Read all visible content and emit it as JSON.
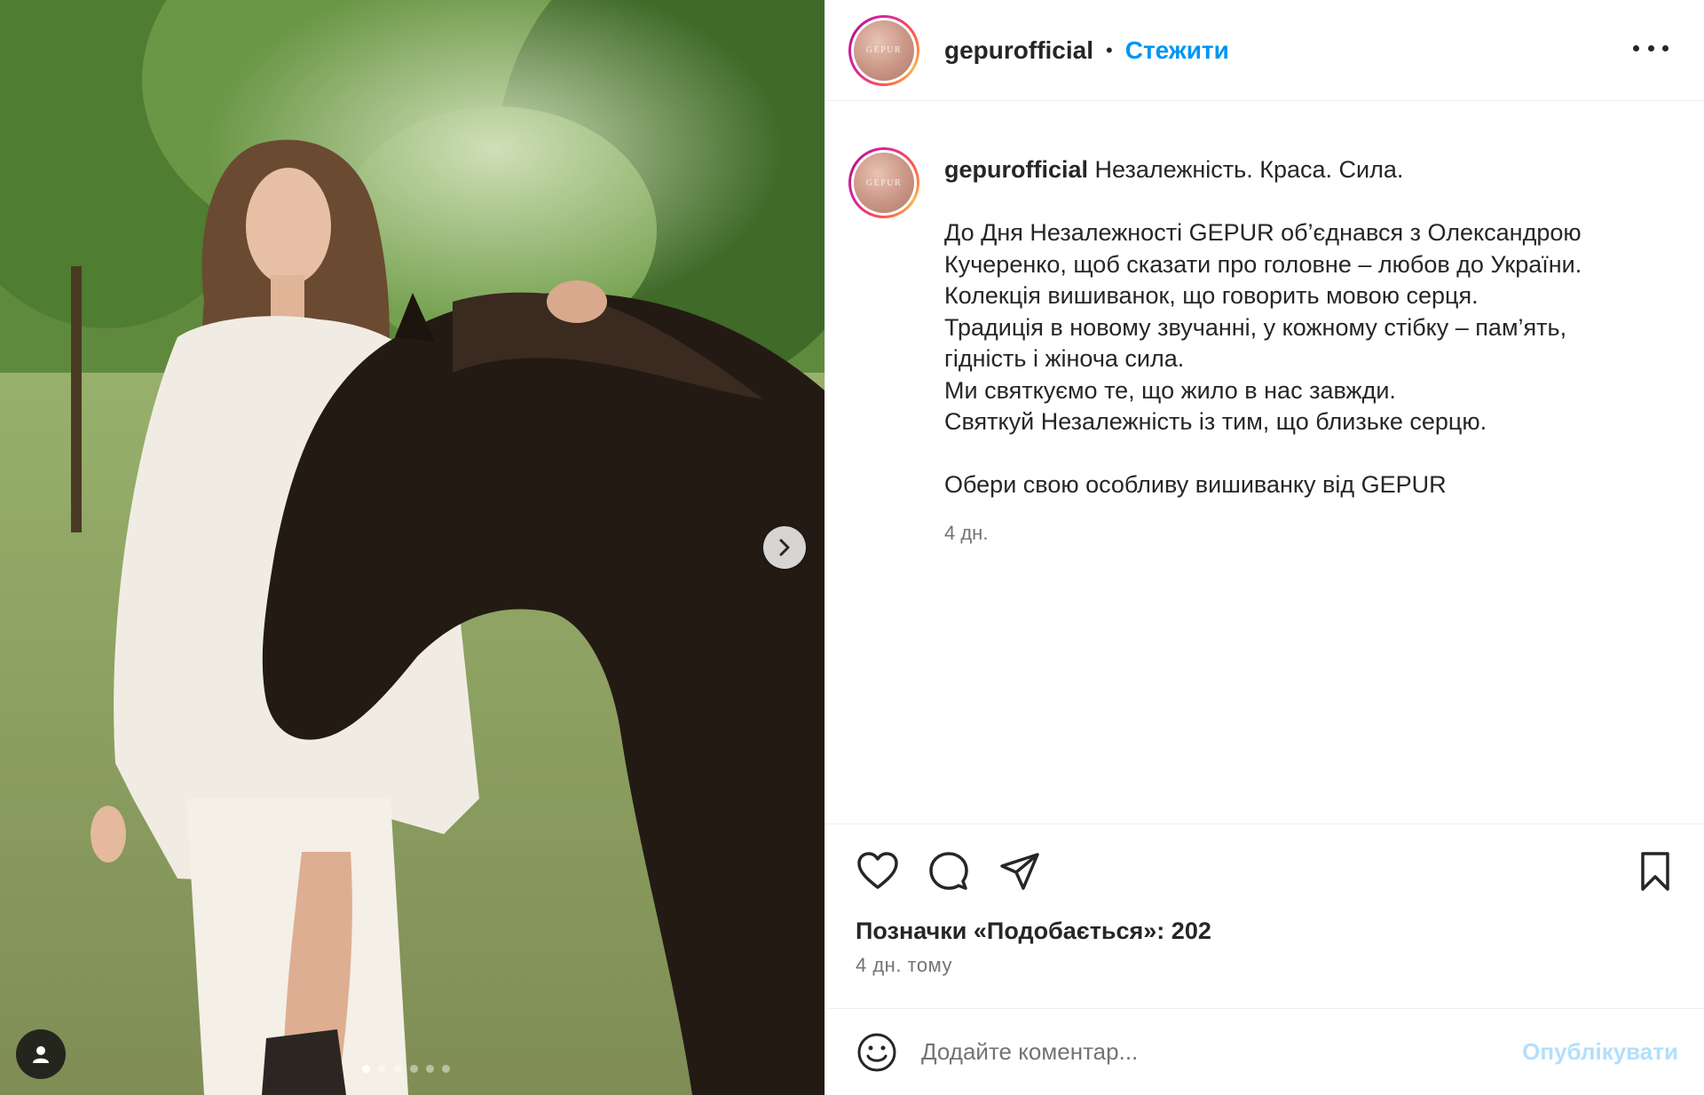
{
  "post": {
    "username": "gepurofficial",
    "separator": "•",
    "follow_label": "Стежити",
    "avatar_text": "GEPUR",
    "caption_lines": [
      "До Дня Незалежності GEPUR об’єднався з Олександрою",
      "Кучеренко, щоб сказати про головне – любов до України.",
      "Колекція вишиванок, що говорить мовою серця.",
      "Традиція в новому звучанні, у кожному стібку – пам’ять,",
      "гідність і жіноча сила.",
      "Ми святкуємо те, що жило в нас завжди.",
      "Святкуй Незалежність із тим, що близьке серцю."
    ],
    "caption_first_line": "Незалежність. Краса. Сила.",
    "caption_closing": "Обери свою особливу вишиванку від GEPUR",
    "caption_time": "4 дн.",
    "likes_text": "Позначки «Подобається»: 202",
    "post_time": "4 дн. тому"
  },
  "comment": {
    "placeholder": "Додайте коментар...",
    "publish_label": "Опублікувати"
  },
  "carousel": {
    "total_slides": 6,
    "active_index": 0
  },
  "icons": {
    "like": "heart-icon",
    "comment": "comment-icon",
    "share": "paper-plane-icon",
    "save": "bookmark-icon",
    "emoji": "smiley-icon",
    "more": "more-dots-icon",
    "next": "chevron-right-icon",
    "tag": "user-tag-icon"
  },
  "colors": {
    "accent": "#0095f6",
    "text": "#262626",
    "secondary": "#737373",
    "publish_disabled": "#b2dffc"
  }
}
